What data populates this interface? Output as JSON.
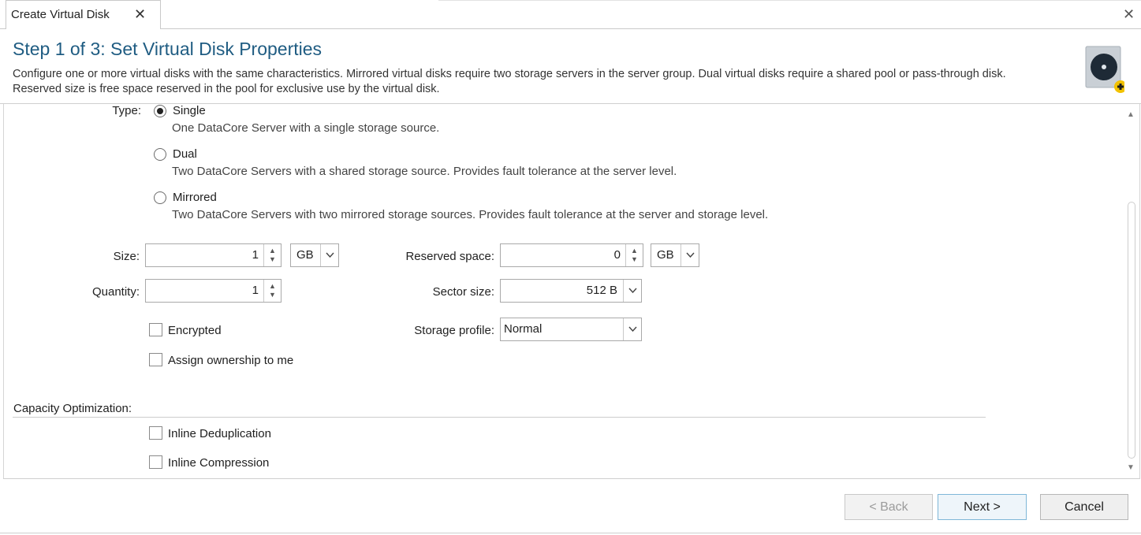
{
  "tab": {
    "title": "Create Virtual Disk",
    "close_glyph": "✕"
  },
  "window": {
    "close_glyph": "✕"
  },
  "header": {
    "title": "Step 1 of 3: Set Virtual Disk Properties",
    "description": "Configure one or more virtual disks with the same characteristics. Mirrored virtual disks require two storage servers in the server group. Dual virtual disks require a shared pool or pass-through disk.  Reserved size is free space reserved in the pool for exclusive use by the virtual disk.",
    "icon": "virtual-disk-add-icon"
  },
  "form": {
    "type_label": "Type:",
    "type_options": [
      {
        "label": "Single",
        "desc": "One DataCore Server with a single storage source.",
        "selected": true
      },
      {
        "label": "Dual",
        "desc": "Two DataCore Servers with a shared storage source. Provides fault tolerance at the server level.",
        "selected": false
      },
      {
        "label": "Mirrored",
        "desc": "Two DataCore Servers with two mirrored storage sources. Provides fault tolerance at the server and storage level.",
        "selected": false
      }
    ],
    "size": {
      "label": "Size:",
      "value": "1",
      "unit": "GB"
    },
    "quantity": {
      "label": "Quantity:",
      "value": "1"
    },
    "reserved_space": {
      "label": "Reserved space:",
      "value": "0",
      "unit": "GB"
    },
    "sector_size": {
      "label": "Sector size:",
      "value": "512 B"
    },
    "storage_profile": {
      "label": "Storage profile:",
      "value": "Normal"
    },
    "encrypted": {
      "label": "Encrypted",
      "checked": false
    },
    "assign_ownership": {
      "label": "Assign ownership to me",
      "checked": false
    },
    "capacity_optimization": {
      "title": "Capacity Optimization:",
      "inline_dedup": {
        "label": "Inline Deduplication",
        "checked": false
      },
      "inline_compression": {
        "label": "Inline Compression",
        "checked": false
      }
    }
  },
  "buttons": {
    "back": "< Back",
    "next": "Next >",
    "cancel": "Cancel"
  },
  "colors": {
    "title": "#1f5c82",
    "accent_badge": "#f2c200"
  }
}
